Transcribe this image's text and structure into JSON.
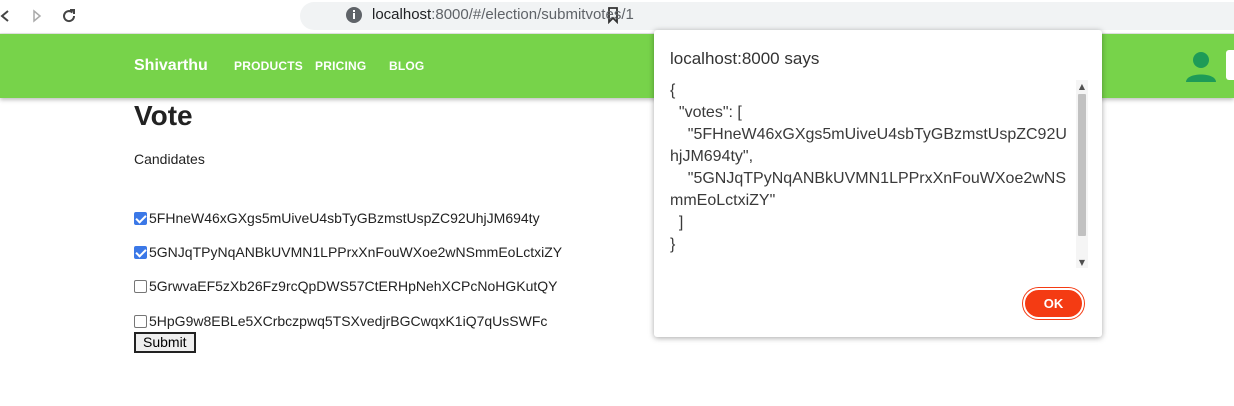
{
  "browser": {
    "url_host": "localhost",
    "url_path": ":8000/#/election/submitvotes/1"
  },
  "navbar": {
    "brand": "Shivarthu",
    "links": [
      "PRODUCTS",
      "PRICING",
      "BLOG"
    ]
  },
  "page": {
    "title": "Vote",
    "subtitle": "Candidates",
    "candidates": [
      {
        "id": "5FHneW46xGXgs5mUiveU4sbTyGBzmstUspZC92UhjJM694ty",
        "checked": true
      },
      {
        "id": "5GNJqTPyNqANBkUVMN1LPPrxXnFouWXoe2wNSmmEoLctxiZY",
        "checked": true
      },
      {
        "id": "5GrwvaEF5zXb26Fz9rcQpDWS57CtERHpNehXCPcNoHGKutQY",
        "checked": false
      },
      {
        "id": "5HpG9w8EBLe5XCrbczpwq5TSXvedjrBGCwqxK1iQ7qUsSWFc",
        "checked": false
      }
    ],
    "submit_label": "Submit"
  },
  "dialog": {
    "title": "localhost:8000 says",
    "message": "{\n  \"votes\": [\n    \"5FHneW46xGXgs5mUiveU4sbTyGBzmstUspZC92UhjJM694ty\",\n    \"5GNJqTPyNqANBkUVMN1LPPrxXnFouWXoe2wNSmmEoLctxiZY\"\n  ]\n}",
    "ok_label": "OK"
  },
  "colors": {
    "navbar_bg": "#77d34a",
    "accent_ok": "#f43b13",
    "checkbox_checked": "#3b78e7",
    "user_icon": "#1e9b57"
  }
}
